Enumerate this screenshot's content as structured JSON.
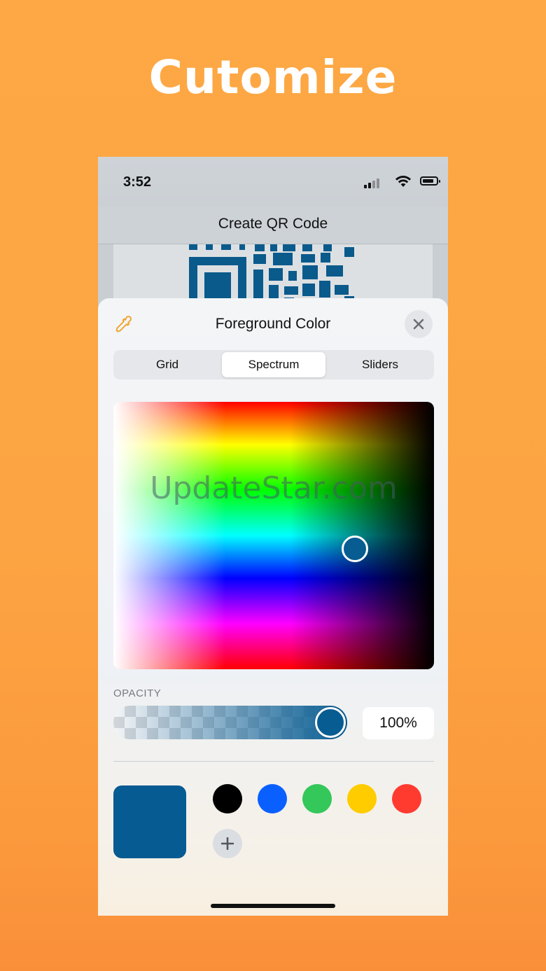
{
  "headline": "Cutomize",
  "status": {
    "time": "3:52"
  },
  "nav": {
    "title": "Create QR Code"
  },
  "sheet": {
    "title": "Foreground Color",
    "tabs": [
      {
        "label": "Grid",
        "active": false
      },
      {
        "label": "Spectrum",
        "active": true
      },
      {
        "label": "Sliders",
        "active": false
      }
    ],
    "watermark": "UpdateStar.com",
    "opacity_label": "OPACITY",
    "opacity_value": "100%",
    "opacity_fraction": 1.0,
    "selected_color": "#055b92",
    "swatches": [
      "#000000",
      "#0a60ff",
      "#34c759",
      "#ffcc00",
      "#ff3b30"
    ]
  },
  "icons": {
    "eyedropper": "eyedropper-icon",
    "close": "close-icon",
    "add": "plus-icon",
    "signal": "cellular-signal-icon",
    "wifi": "wifi-icon",
    "battery": "battery-icon"
  }
}
